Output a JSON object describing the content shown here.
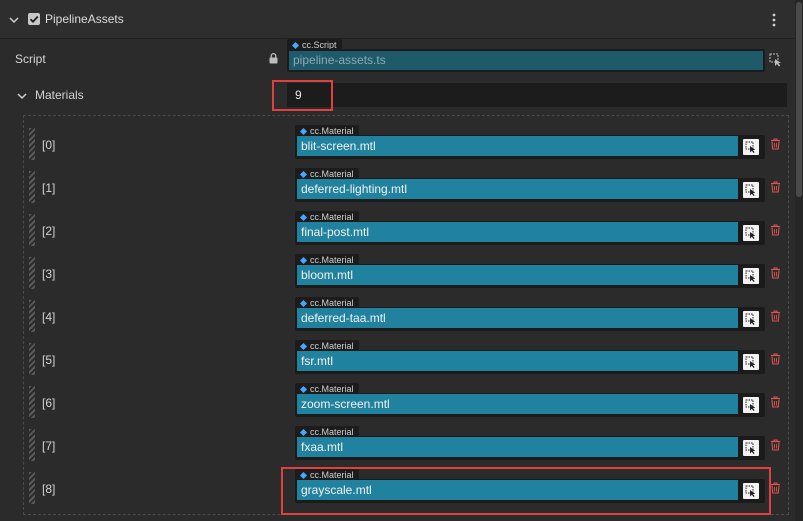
{
  "component": {
    "title": "PipelineAssets",
    "enabled": true
  },
  "script_row": {
    "label": "Script",
    "type_tag": "cc.Script",
    "value": "pipeline-assets.ts"
  },
  "materials": {
    "label": "Materials",
    "count": "9",
    "type_tag": "cc.Material",
    "items": [
      {
        "index": "[0]",
        "value": "blit-screen.mtl"
      },
      {
        "index": "[1]",
        "value": "deferred-lighting.mtl"
      },
      {
        "index": "[2]",
        "value": "final-post.mtl"
      },
      {
        "index": "[3]",
        "value": "bloom.mtl"
      },
      {
        "index": "[4]",
        "value": "deferred-taa.mtl"
      },
      {
        "index": "[5]",
        "value": "fsr.mtl"
      },
      {
        "index": "[6]",
        "value": "zoom-screen.mtl"
      },
      {
        "index": "[7]",
        "value": "fxaa.mtl"
      },
      {
        "index": "[8]",
        "value": "grayscale.mtl"
      }
    ]
  },
  "icons": {
    "collapse": "chevron-down-icon",
    "menu": "kebab-menu-icon",
    "lock": "lock-icon",
    "pick": "asset-picker-icon",
    "delete": "trash-icon"
  },
  "colors": {
    "asset_field": "#21829f",
    "highlight": "#e2403f",
    "delete_icon": "#d9534f",
    "type_diamond": "#49a6ff"
  }
}
